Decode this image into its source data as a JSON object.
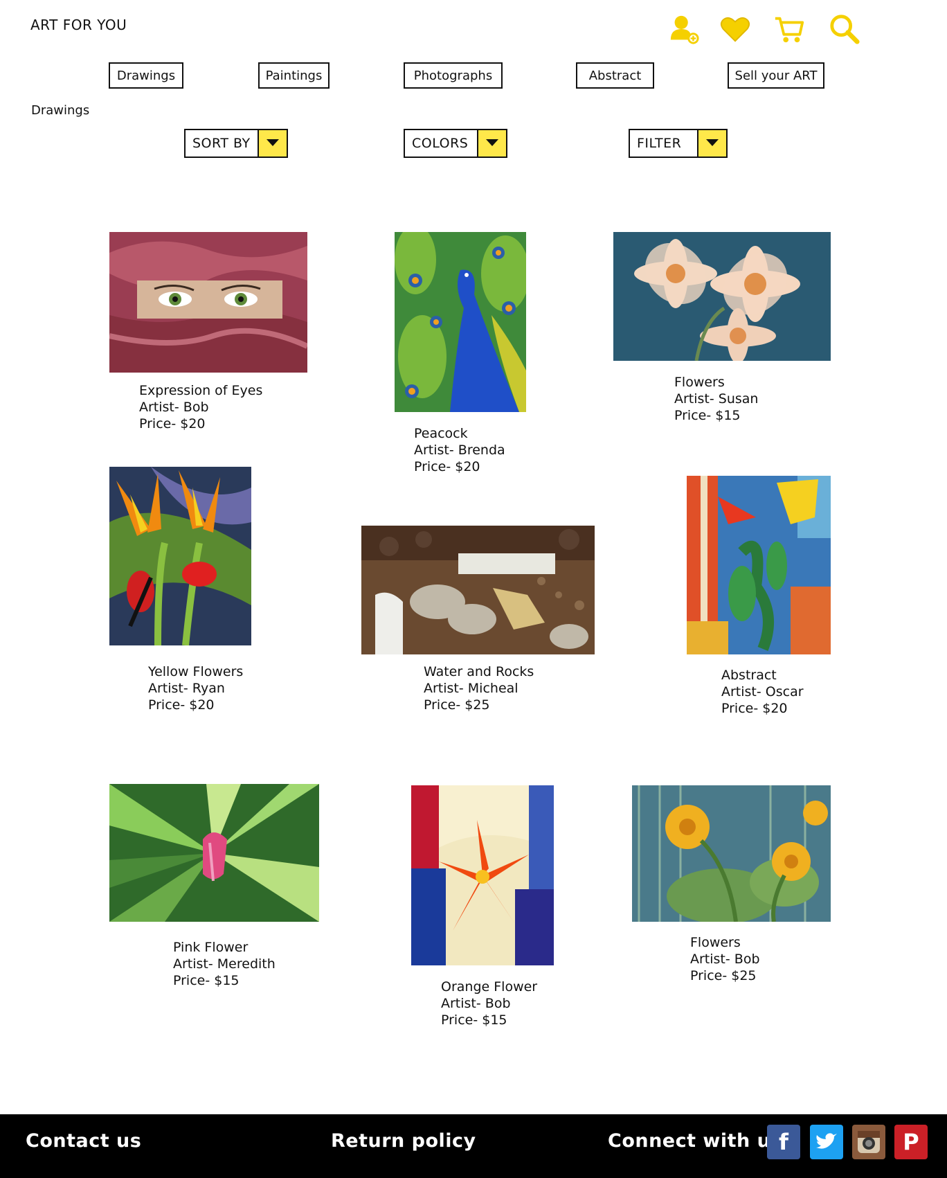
{
  "header": {
    "site_title": "ART FOR YOU",
    "icons": [
      "add-user-icon",
      "heart-icon",
      "cart-icon",
      "search-icon"
    ],
    "accent_color": "#f5d000"
  },
  "nav": {
    "drawings": "Drawings",
    "paintings": "Paintings",
    "photographs": "Photographs",
    "abstract": "Abstract",
    "sell": "Sell your ART"
  },
  "section": {
    "title": "Drawings"
  },
  "filters": {
    "sort_by": "SORT BY",
    "colors": "COLORS",
    "filter": "FILTER",
    "arrow_color": "#ffe84a"
  },
  "artworks": [
    {
      "title": "Expression of Eyes",
      "artist": "Artist- Bob",
      "price": "Price- $20"
    },
    {
      "title": "Peacock",
      "artist": "Artist- Brenda",
      "price": "Price- $20"
    },
    {
      "title": "Flowers",
      "artist": "Artist- Susan",
      "price": "Price- $15"
    },
    {
      "title": "Yellow Flowers",
      "artist": "Artist- Ryan",
      "price": "Price- $20"
    },
    {
      "title": "Water and Rocks",
      "artist": "Artist- Micheal",
      "price": "Price- $25"
    },
    {
      "title": "Abstract",
      "artist": "Artist- Oscar",
      "price": "Price- $20"
    },
    {
      "title": "Pink Flower",
      "artist": "Artist- Meredith",
      "price": "Price- $15"
    },
    {
      "title": "Orange Flower",
      "artist": "Artist- Bob",
      "price": "Price- $15"
    },
    {
      "title": "Flowers",
      "artist": "Artist- Bob",
      "price": "Price- $25"
    }
  ],
  "footer": {
    "contact": "Contact us",
    "return_policy": "Return policy",
    "connect": "Connect with us :",
    "social": [
      {
        "icon": "facebook-icon",
        "glyph": "f",
        "color": "#3b5998"
      },
      {
        "icon": "twitter-icon",
        "glyph": "t",
        "color": "#1da1f2"
      },
      {
        "icon": "instagram-icon",
        "glyph": "",
        "color": "#8a5a3c"
      },
      {
        "icon": "pinterest-icon",
        "glyph": "P",
        "color": "#cb2027"
      }
    ]
  }
}
